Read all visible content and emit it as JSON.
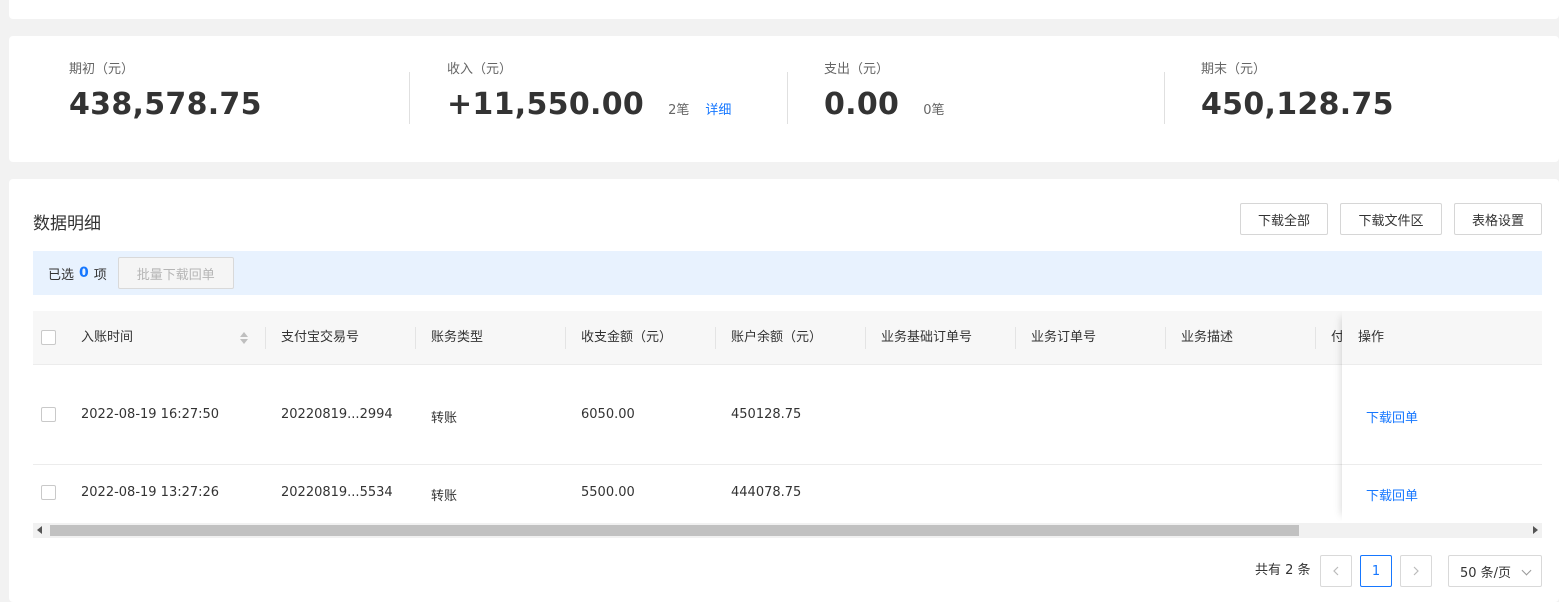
{
  "summary": {
    "opening": {
      "label": "期初（元）",
      "value": "438,578.75"
    },
    "income": {
      "label": "收入（元）",
      "value": "+11,550.00",
      "count": "2笔",
      "link": "详细"
    },
    "expense": {
      "label": "支出（元）",
      "value": "0.00",
      "count": "0笔"
    },
    "closing": {
      "label": "期末（元）",
      "value": "450,128.75"
    }
  },
  "detail": {
    "title": "数据明细",
    "buttons": {
      "download_all": "下载全部",
      "download_area": "下载文件区",
      "table_settings": "表格设置"
    }
  },
  "selection": {
    "prefix": "已选",
    "count": "0",
    "suffix": "项",
    "batch_button": "批量下载回单"
  },
  "table": {
    "columns": [
      "入账时间",
      "支付宝交易号",
      "账务类型",
      "收支金额（元）",
      "账户余额（元）",
      "业务基础订单号",
      "业务订单号",
      "业务描述",
      "付",
      "操作"
    ],
    "rows": [
      {
        "time": "2022-08-19 16:27:50",
        "trade_no": "20220819...2994",
        "type": "转账",
        "amount": "6050.00",
        "balance": "450128.75",
        "action": "下载回单"
      },
      {
        "time": "2022-08-19 13:27:26",
        "trade_no": "20220819...5534",
        "type": "转账",
        "amount": "5500.00",
        "balance": "444078.75",
        "action": "下载回单"
      }
    ]
  },
  "pagination": {
    "total": "共有 2 条",
    "current_page": "1",
    "page_size": "50 条/页"
  },
  "colors": {
    "accent": "#1677ff",
    "select_bar_bg": "#e8f2fe"
  }
}
